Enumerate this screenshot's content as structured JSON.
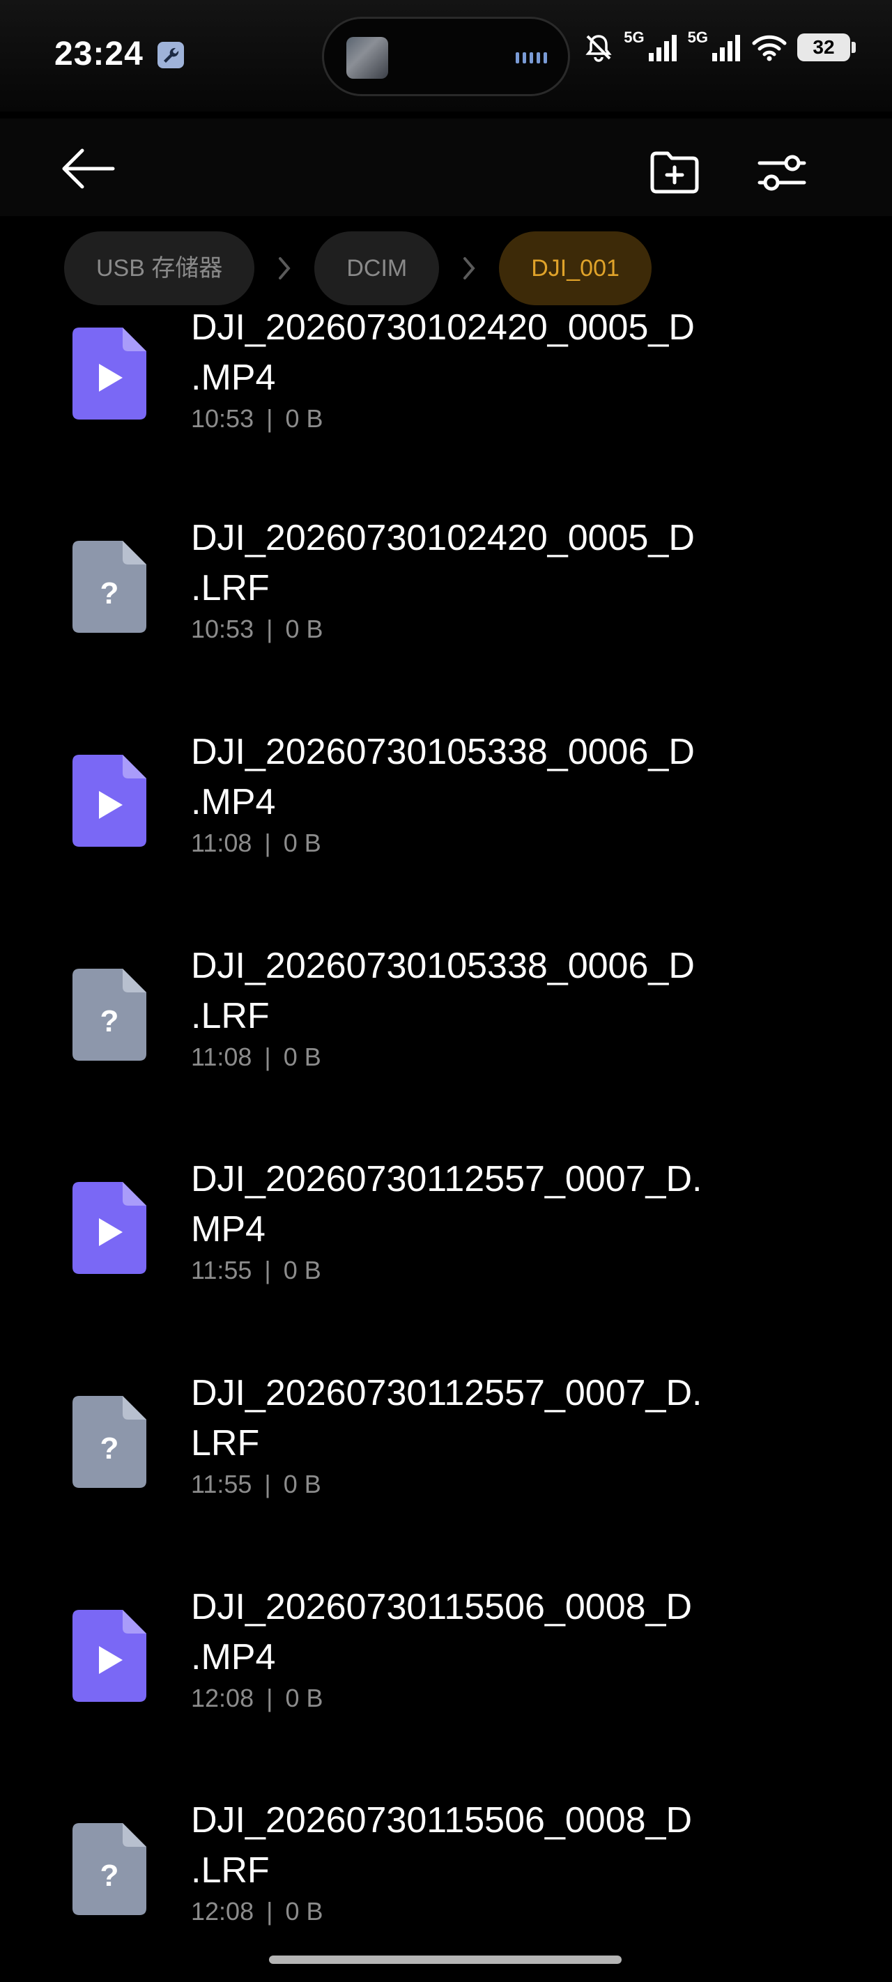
{
  "status_bar": {
    "time": "23:24",
    "network_1": "5G",
    "network_2": "5G",
    "battery": "32"
  },
  "toolbar": {
    "back_icon": "back-arrow-icon",
    "new_folder_icon": "new-folder-icon",
    "settings_icon": "sliders-icon"
  },
  "breadcrumb": [
    {
      "label": "USB 存储器"
    },
    {
      "label": "DCIM"
    },
    {
      "label": "DJI_001"
    }
  ],
  "colors": {
    "video_icon": "#7a68f5",
    "unknown_icon": "#8d97ab",
    "active_crumb_bg": "#3d2a08",
    "active_crumb_text": "#e0a32a"
  },
  "files": [
    {
      "name_line1": "DJI_20260730102420_0005_D",
      "name_line2": ".MP4",
      "time": "10:53",
      "size": "0 B",
      "icon": "video-file-icon"
    },
    {
      "name_line1": "DJI_20260730102420_0005_D",
      "name_line2": ".LRF",
      "time": "10:53",
      "size": "0 B",
      "icon": "unknown-file-icon"
    },
    {
      "name_line1": "DJI_20260730105338_0006_D",
      "name_line2": ".MP4",
      "time": "11:08",
      "size": "0 B",
      "icon": "video-file-icon"
    },
    {
      "name_line1": "DJI_20260730105338_0006_D",
      "name_line2": ".LRF",
      "time": "11:08",
      "size": "0 B",
      "icon": "unknown-file-icon"
    },
    {
      "name_line1": "DJI_20260730112557_0007_D.",
      "name_line2": "MP4",
      "time": "11:55",
      "size": "0 B",
      "icon": "video-file-icon"
    },
    {
      "name_line1": "DJI_20260730112557_0007_D.",
      "name_line2": "LRF",
      "time": "11:55",
      "size": "0 B",
      "icon": "unknown-file-icon"
    },
    {
      "name_line1": "DJI_20260730115506_0008_D",
      "name_line2": ".MP4",
      "time": "12:08",
      "size": "0 B",
      "icon": "video-file-icon"
    },
    {
      "name_line1": "DJI_20260730115506_0008_D",
      "name_line2": ".LRF",
      "time": "12:08",
      "size": "0 B",
      "icon": "unknown-file-icon"
    }
  ]
}
